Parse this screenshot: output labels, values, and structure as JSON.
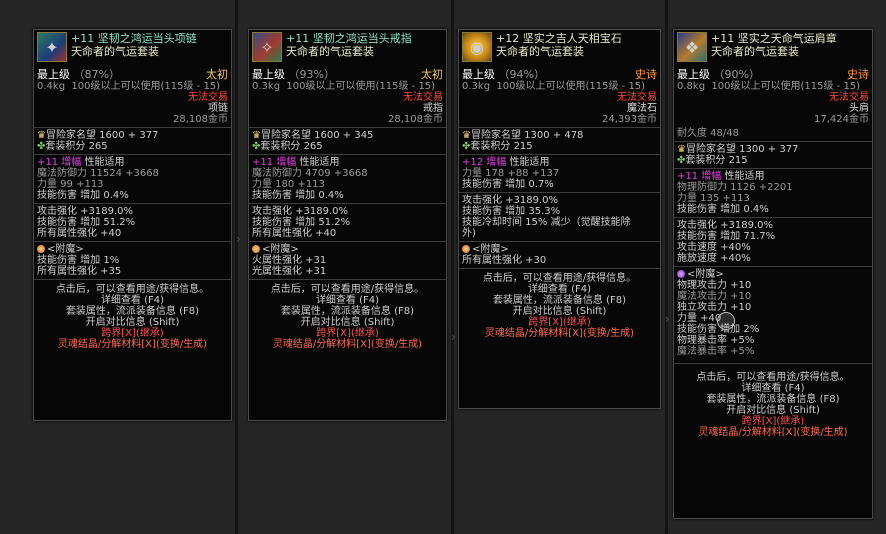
{
  "tooltips": [
    {
      "icon": "necklace-icon",
      "name1": "+11 坚韧之鸿运当头项链",
      "name2": "天命者的气运套装",
      "level": "最上级",
      "pct": "（87%）",
      "tier": "太初",
      "weight": "0.4kg",
      "req": "100级以上可以使用(115级 - 15)",
      "trade": "无法交易",
      "slot": "项链",
      "price": "28,108金币",
      "rep": "冒险家名望 1600 + 377",
      "setpt": "套装积分 265",
      "amp": [
        "+11",
        "增幅",
        "性能适用"
      ],
      "def": "魔法防御力 11524 +3668",
      "stat": "力量 99 +113",
      "skl": "技能伤害  增加 0.4%",
      "block": [
        "攻击强化 +3189.0%",
        "技能伤害  增加 51.2%",
        "所有属性强化 +40"
      ],
      "ench": "<附魔>",
      "enchLines": [
        "技能伤害  增加 1%",
        "所有属性强化 +35"
      ]
    },
    {
      "icon": "ring-icon",
      "name1": "+11 坚韧之鸿运当头戒指",
      "name2": "天命者的气运套装",
      "level": "最上级",
      "pct": "（93%）",
      "tier": "太初",
      "weight": "0.3kg",
      "req": "100级以上可以使用(115级 - 15)",
      "trade": "无法交易",
      "slot": "戒指",
      "price": "28,108金币",
      "rep": "冒险家名望 1600 + 345",
      "setpt": "套装积分 265",
      "amp": [
        "+11",
        "增幅",
        "性能适用"
      ],
      "def": "魔法防御力 4709 +3668",
      "stat": "力量 180 +113",
      "skl": "技能伤害  增加 0.4%",
      "block": [
        "攻击强化 +3189.0%",
        "技能伤害  增加 51.2%",
        "所有属性强化 +40"
      ],
      "ench": "<附魔>",
      "enchLines": [
        "火属性强化 +31",
        "光属性强化 +31"
      ]
    },
    {
      "icon": "gem-icon",
      "name1": "+12 坚实之吉人天相宝石",
      "name2": "天命者的气运套装",
      "level": "最上级",
      "pct": "（94%）",
      "tier": "史诗",
      "weight": "0.3kg",
      "req": "100级以上可以使用(115级 - 15)",
      "trade": "无法交易",
      "slot": "魔法石",
      "price": "24,393金币",
      "rep": "冒险家名望 1300 + 478",
      "setpt": "套装积分 215",
      "amp": [
        "+12",
        "增幅",
        "性能适用"
      ],
      "stat": "力量 178 +88 +137",
      "skl": "技能伤害  增加 0.7%",
      "block": [
        "攻击强化 +3189.0%",
        "技能伤害  增加 35.3%",
        "技能冷却时间 15% 减少（觉醒技能除",
        "外)"
      ],
      "ench": "<附魔>",
      "enchLines": [
        "所有属性强化 +30"
      ]
    },
    {
      "icon": "shoulder-icon",
      "name1": "+11 坚实之天命气运肩章",
      "name2": "天命者的气运套装",
      "level": "最上级",
      "pct": "（90%）",
      "tier": "史诗",
      "weight": "0.8kg",
      "req": "100级以上可以使用(115级 - 15)",
      "trade": "无法交易",
      "slot": "头肩",
      "price": "17,424金币",
      "dur": "耐久度 48/48",
      "rep": "冒险家名望 1300 + 377",
      "setpt": "套装积分 215",
      "amp": [
        "+11",
        "增幅",
        "性能适用"
      ],
      "def": "物理防御力 1126 +2201",
      "stat": "力量 135 +113",
      "skl": "技能伤害  增加 0.4%",
      "block": [
        "攻击强化 +3189.0%",
        "技能伤害  增加 71.7%",
        "攻击速度 +40%",
        "施放速度 +40%"
      ],
      "ench": "<附魔>",
      "enchLines": [
        "物理攻击力 +10",
        "魔法攻击力 +10",
        "独立攻击力 +10",
        "力量 +40",
        "技能伤害  增加 2%",
        "物理暴击率 +5%",
        "魔法暴击率 +5%"
      ]
    }
  ],
  "info": {
    "l1": "点击后，可以查看用途/获得信息。",
    "l2": "详细查看 (F4)",
    "l3": "套装属性，流派装备信息 (F8)",
    "l4": "开启对比信息 (Shift)",
    "l5": "跨界[X](继承)",
    "l6": "灵魂结晶/分解材料[X](变换/生成)"
  }
}
